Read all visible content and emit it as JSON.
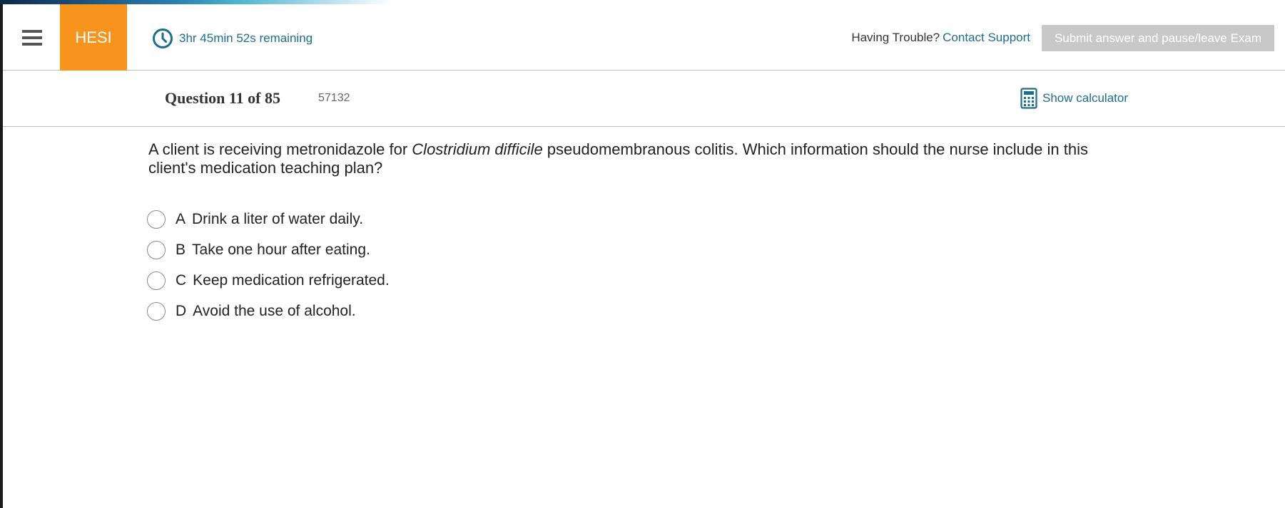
{
  "header": {
    "brand": "HESI",
    "timer_text": "3hr 45min 52s remaining",
    "trouble_label": "Having Trouble?",
    "contact_link": "Contact Support",
    "submit_label": "Submit answer and pause/leave Exam"
  },
  "question_bar": {
    "question_number": "Question 11 of 85",
    "question_id": "57132",
    "calculator_label": "Show calculator"
  },
  "question": {
    "text_before": "A client is receiving metronidazole for ",
    "text_italic": "Clostridium difficile",
    "text_after": " pseudomembranous colitis. Which information should the nurse include in this client's medication teaching plan?"
  },
  "options": [
    {
      "letter": "A",
      "text": "Drink a liter of water daily."
    },
    {
      "letter": "B",
      "text": "Take one hour after eating."
    },
    {
      "letter": "C",
      "text": "Keep medication refrigerated."
    },
    {
      "letter": "D",
      "text": "Avoid the use of alcohol."
    }
  ],
  "colors": {
    "brand_bg": "#f7941d",
    "link": "#1b6e8f",
    "submit_disabled": "#c8c8c8"
  },
  "icons": {
    "menu": "hamburger-menu-icon",
    "timer": "clock-icon",
    "calculator": "calculator-icon"
  }
}
